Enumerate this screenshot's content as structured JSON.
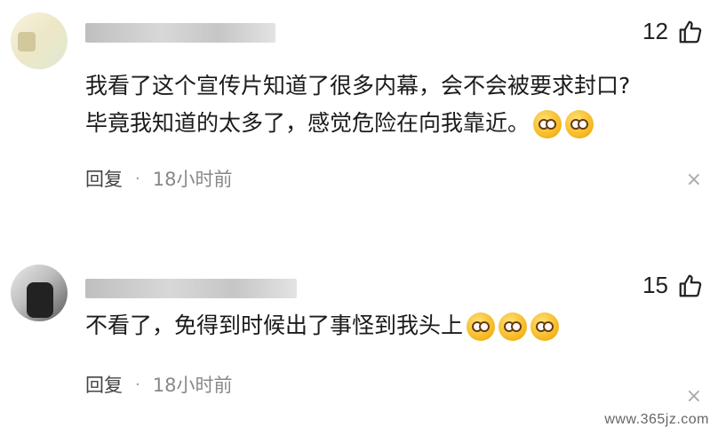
{
  "comments": [
    {
      "likes": "12",
      "line1": "我看了这个宣传片知道了很多内幕，会不会被要求封口?",
      "line2": "毕竟我知道的太多了，感觉危险在向我靠近。",
      "reply": "回复",
      "dot": "·",
      "time": "18小时前",
      "close": "×"
    },
    {
      "likes": "15",
      "line1": "不看了，免得到时候出了事怪到我头上",
      "reply": "回复",
      "dot": "·",
      "time": "18小时前",
      "close": "×"
    }
  ],
  "watermark": "www.365jz.com",
  "icons": {
    "like": "thumbs-up-icon",
    "close": "close-icon"
  }
}
